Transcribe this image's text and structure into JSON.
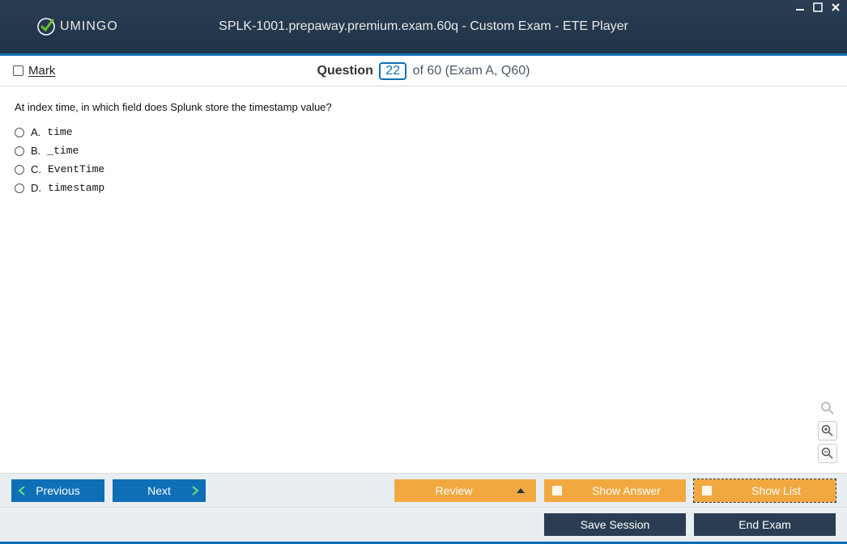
{
  "logo_text": "UMINGO",
  "app_title": "SPLK-1001.prepaway.premium.exam.60q - Custom Exam - ETE Player",
  "mark_label": "Mark",
  "question_header": {
    "question_word": "Question",
    "current": "22",
    "of_text": "of 60 (Exam A, Q60)"
  },
  "question_text": "At index time, in which field does Splunk store the timestamp value?",
  "answers": [
    {
      "letter": "A.",
      "text": "time"
    },
    {
      "letter": "B.",
      "text": "_time"
    },
    {
      "letter": "C.",
      "text": "EventTime"
    },
    {
      "letter": "D.",
      "text": "timestamp"
    }
  ],
  "buttons": {
    "previous": "Previous",
    "next": "Next",
    "review": "Review",
    "show_answer": "Show Answer",
    "show_list": "Show List",
    "save_session": "Save Session",
    "end_exam": "End Exam"
  }
}
